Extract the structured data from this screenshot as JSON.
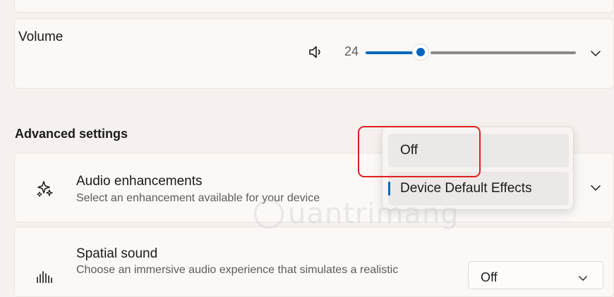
{
  "volume": {
    "label": "Volume",
    "value": "24",
    "level": 0.24,
    "icon": "speaker-icon"
  },
  "advanced": {
    "heading": "Advanced settings"
  },
  "audio_enhancements": {
    "title": "Audio enhancements",
    "subtitle": "Select an enhancement available for your device",
    "icon": "sparkle-icon"
  },
  "flyout": {
    "options": [
      "Off",
      "Device Default Effects"
    ],
    "selected": "Device Default Effects"
  },
  "spatial_sound": {
    "title": "Spatial sound",
    "subtitle": "Choose an immersive audio experience that simulates a realistic",
    "selected": "Off",
    "icon": "spatial-sound-icon"
  },
  "watermark": {
    "text": "uantrimang"
  },
  "colors": {
    "accent": "#0067c0",
    "highlight": "#e02020"
  }
}
